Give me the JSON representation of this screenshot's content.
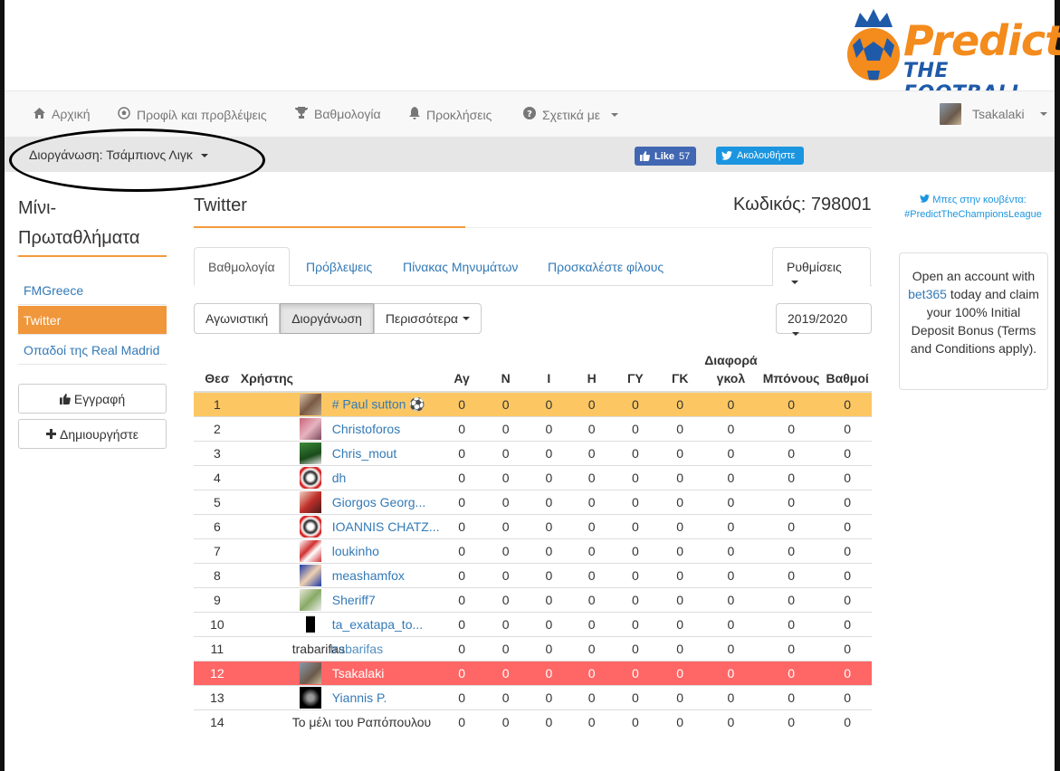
{
  "logo": {
    "line1": "Predict",
    "line2": "THE FOOTBALL"
  },
  "nav": {
    "items": [
      {
        "label": "Αρχική",
        "icon": "home-icon"
      },
      {
        "label": "Προφίλ και προβλέψεις",
        "icon": "soccer-ball-icon"
      },
      {
        "label": "Βαθμολογία",
        "icon": "trophy-icon"
      },
      {
        "label": "Προκλήσεις",
        "icon": "bell-icon"
      },
      {
        "label": "Σχετικά με",
        "icon": "question-circle-icon"
      }
    ],
    "user": "Tsakalaki"
  },
  "subbar": {
    "tournament": "Διοργάνωση: Τσάμπιονς Λιγκ",
    "fb_like": "Like",
    "fb_count": "57",
    "tw_follow": "Ακολουθήστε"
  },
  "sidebar": {
    "title_line1": "Μίνι-",
    "title_line2": "Πρωταθλήματα",
    "items": [
      {
        "label": "FMGreece",
        "active": false
      },
      {
        "label": "Twitter",
        "active": true
      },
      {
        "label": "Οπαδοί της Real Madrid",
        "active": false
      }
    ],
    "register_button": "Εγγραφή",
    "create_button": "Δημιουργήστε"
  },
  "main": {
    "title": "Twitter",
    "code": "Κωδικός: 798001",
    "tabs": [
      "Βαθμολογία",
      "Πρόβλεψεις",
      "Πίνακας Μηνυμάτων",
      "Προσκαλέστε φίλους"
    ],
    "settings": "Ρυθμίσεις",
    "filters": [
      "Αγωνιστική",
      "Διοργάνωση",
      "Περισσότερα"
    ],
    "season": "2019/2020"
  },
  "table": {
    "headers": {
      "pos": "Θεσ",
      "user": "Χρήστης",
      "played": "Αγ",
      "won": "Ν",
      "draw": "Ι",
      "lost": "Η",
      "gf": "ΓΥ",
      "ga": "ΓΚ",
      "diff_line1": "Διαφορά",
      "diff_line2": "γκολ",
      "bonus": "Μπόνους",
      "points": "Βαθμοί"
    },
    "rows": [
      {
        "pos": "1",
        "user": "# Paul sutton ⚽",
        "vals": [
          "0",
          "0",
          "0",
          "0",
          "0",
          "0",
          "0",
          "0",
          "0"
        ]
      },
      {
        "pos": "2",
        "user": "Christoforos",
        "vals": [
          "0",
          "0",
          "0",
          "0",
          "0",
          "0",
          "0",
          "0",
          "0"
        ]
      },
      {
        "pos": "3",
        "user": "Chris_mout",
        "vals": [
          "0",
          "0",
          "0",
          "0",
          "0",
          "0",
          "0",
          "0",
          "0"
        ]
      },
      {
        "pos": "4",
        "user": "dh",
        "vals": [
          "0",
          "0",
          "0",
          "0",
          "0",
          "0",
          "0",
          "0",
          "0"
        ]
      },
      {
        "pos": "5",
        "user": "Giorgos Georg...",
        "vals": [
          "0",
          "0",
          "0",
          "0",
          "0",
          "0",
          "0",
          "0",
          "0"
        ]
      },
      {
        "pos": "6",
        "user": "IOANNIS CHATZ...",
        "vals": [
          "0",
          "0",
          "0",
          "0",
          "0",
          "0",
          "0",
          "0",
          "0"
        ]
      },
      {
        "pos": "7",
        "user": "loukinho",
        "vals": [
          "0",
          "0",
          "0",
          "0",
          "0",
          "0",
          "0",
          "0",
          "0"
        ]
      },
      {
        "pos": "8",
        "user": "meashamfox",
        "vals": [
          "0",
          "0",
          "0",
          "0",
          "0",
          "0",
          "0",
          "0",
          "0"
        ]
      },
      {
        "pos": "9",
        "user": "Sheriff7",
        "vals": [
          "0",
          "0",
          "0",
          "0",
          "0",
          "0",
          "0",
          "0",
          "0"
        ]
      },
      {
        "pos": "10",
        "user": "ta_exatapa_to...",
        "vals": [
          "0",
          "0",
          "0",
          "0",
          "0",
          "0",
          "0",
          "0",
          "0"
        ]
      },
      {
        "pos": "11",
        "user": "trabarifas",
        "ghost": "trabarifas",
        "vals": [
          "0",
          "0",
          "0",
          "0",
          "0",
          "0",
          "0",
          "0",
          "0"
        ]
      },
      {
        "pos": "12",
        "user": "Tsakalaki",
        "vals": [
          "0",
          "0",
          "0",
          "0",
          "0",
          "0",
          "0",
          "0",
          "0"
        ]
      },
      {
        "pos": "13",
        "user": "Yiannis P.",
        "vals": [
          "0",
          "0",
          "0",
          "0",
          "0",
          "0",
          "0",
          "0",
          "0"
        ]
      },
      {
        "pos": "14",
        "user": "Το μέλι του Pαπόπουλου",
        "vals": [
          "0",
          "0",
          "0",
          "0",
          "0",
          "0",
          "0",
          "0",
          "0"
        ]
      }
    ]
  },
  "right": {
    "tw_line1": "Μπες στην κουβέντα:",
    "tw_line2": "#PredictTheChampionsLeague",
    "ad_part1": "Open an account with",
    "ad_link": "bet365",
    "ad_part2": "today and claim your 100% Initial Deposit Bonus (Terms and Conditions apply)."
  },
  "colors": {
    "accent": "#f0963b",
    "highlight_row": "#fcc762",
    "current_user_row": "#ff6666",
    "link": "#337ab7"
  }
}
